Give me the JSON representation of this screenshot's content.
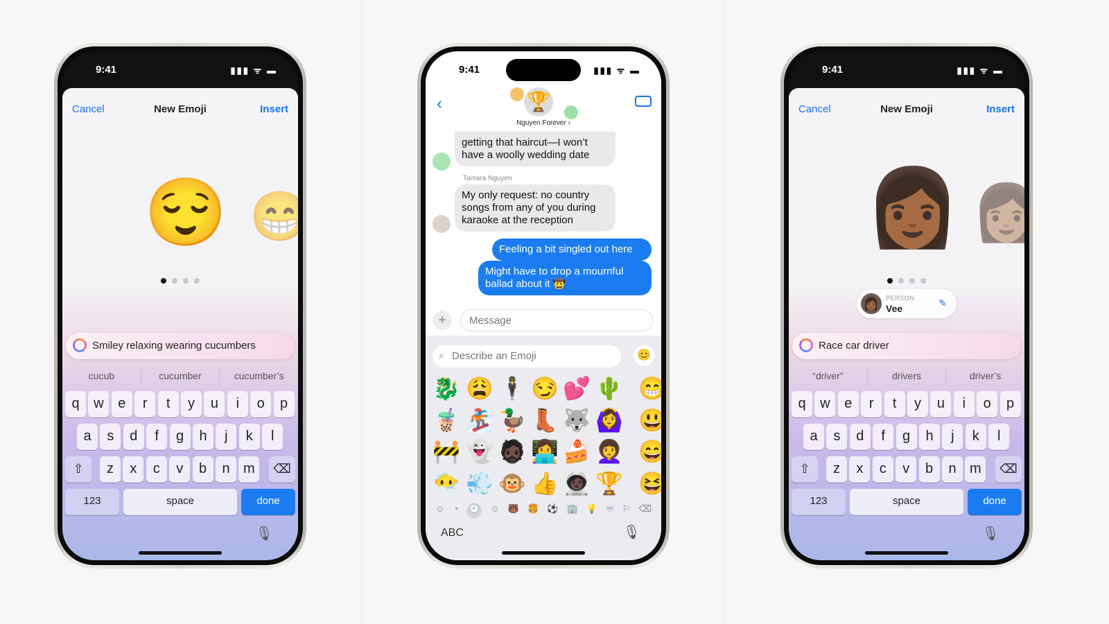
{
  "status": {
    "time": "9:41",
    "icons": "▮▮▮ ᯤ ▬"
  },
  "left": {
    "cancel": "Cancel",
    "title": "New Emoji",
    "insert": "Insert",
    "emoji_main": "😌",
    "emoji_next": "😁",
    "prompt": "Smiley relaxing wearing cucumbers",
    "suggestions": [
      "cucub",
      "cucumber",
      "cucumber’s"
    ],
    "active_page": 1,
    "pages": 4
  },
  "middle": {
    "group_name": "Nguyen Forever ›",
    "group_avatar": "🏆",
    "messages": [
      {
        "type": "in",
        "text": "getting that haircut—I won’t have a woolly wedding date"
      },
      {
        "type": "in",
        "sender": "Tamara Nguyen",
        "text": "My only request: no country songs from any of you during karaoke at the reception"
      },
      {
        "type": "out",
        "text": "Feeling a bit singled out here"
      },
      {
        "type": "out",
        "text": "Might have to drop a mournful ballad about it 🤠"
      }
    ],
    "message_placeholder": "Message",
    "emoji_search_placeholder": "Describe an Emoji",
    "emoji_rows": [
      [
        "🐉",
        "😩",
        "🕴️",
        "😏",
        "💕",
        "🌵",
        "😁"
      ],
      [
        "🧋",
        "🏂",
        "🦆",
        "👢",
        "🐺",
        "🙆‍♀️",
        "😃"
      ],
      [
        "🚧",
        "👻",
        "🧔🏿",
        "👩‍💻",
        "🍰",
        "👩‍🦱",
        "😄"
      ],
      [
        "😶‍🌫️",
        "💨",
        "🐵",
        "👍",
        "🧑🏿‍🚀",
        "🏆",
        "😆"
      ]
    ],
    "categories": [
      "☺",
      "◔",
      "🕘",
      "☺",
      "🐻",
      "🍔",
      "⚽",
      "🏢",
      "💡",
      "♾",
      "⚐"
    ],
    "selected_category": 2,
    "abc": "ABC"
  },
  "right": {
    "cancel": "Cancel",
    "title": "New Emoji",
    "insert": "Insert",
    "emoji_main": "👩🏾",
    "emoji_next": "👩🏽",
    "person_label": "PERSON",
    "person_name": "Vee",
    "prompt": "Race car driver",
    "suggestions": [
      "“driver”",
      "drivers",
      "driver’s"
    ],
    "active_page": 1,
    "pages": 4
  },
  "keyboard": {
    "rows": [
      [
        "q",
        "w",
        "e",
        "r",
        "t",
        "y",
        "u",
        "i",
        "o",
        "p"
      ],
      [
        "a",
        "s",
        "d",
        "f",
        "g",
        "h",
        "j",
        "k",
        "l"
      ],
      [
        "z",
        "x",
        "c",
        "v",
        "b",
        "n",
        "m"
      ]
    ],
    "numbers": "123",
    "space": "space",
    "done": "done",
    "shift": "⇧",
    "delete": "⌫"
  },
  "colors": {
    "accent": "#1a7cf0"
  }
}
